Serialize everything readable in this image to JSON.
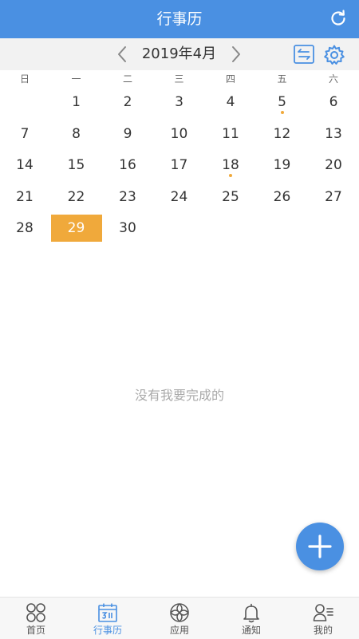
{
  "header": {
    "title": "行事历",
    "refresh_icon": "refresh-icon"
  },
  "month_nav": {
    "label": "2019年4月",
    "prev_icon": "chevron-left-icon",
    "next_icon": "chevron-right-icon",
    "swap_icon": "swap-icon",
    "settings_icon": "gear-icon"
  },
  "weekdays": [
    "日",
    "一",
    "二",
    "三",
    "四",
    "五",
    "六"
  ],
  "calendar": {
    "days": [
      "1",
      "2",
      "3",
      "4",
      "5",
      "6",
      "7",
      "8",
      "9",
      "10",
      "11",
      "12",
      "13",
      "14",
      "15",
      "16",
      "17",
      "18",
      "19",
      "20",
      "21",
      "22",
      "23",
      "24",
      "25",
      "26",
      "27",
      "28",
      "29",
      "30"
    ],
    "first_weekday": 1,
    "selected_day": "29",
    "event_days": [
      "5",
      "18"
    ]
  },
  "empty_message": "没有我要完成的",
  "fab": {
    "icon": "plus-icon"
  },
  "tabs": [
    {
      "label": "首页",
      "icon": "home-grid-icon",
      "active": false
    },
    {
      "label": "行事历",
      "icon": "calendar-icon",
      "active": true
    },
    {
      "label": "应用",
      "icon": "apps-petal-icon",
      "active": false
    },
    {
      "label": "通知",
      "icon": "bell-icon",
      "active": false
    },
    {
      "label": "我的",
      "icon": "profile-icon",
      "active": false
    }
  ],
  "colors": {
    "primary": "#4a90e2",
    "accent": "#f0a93b",
    "muted": "#aaaaaa"
  }
}
